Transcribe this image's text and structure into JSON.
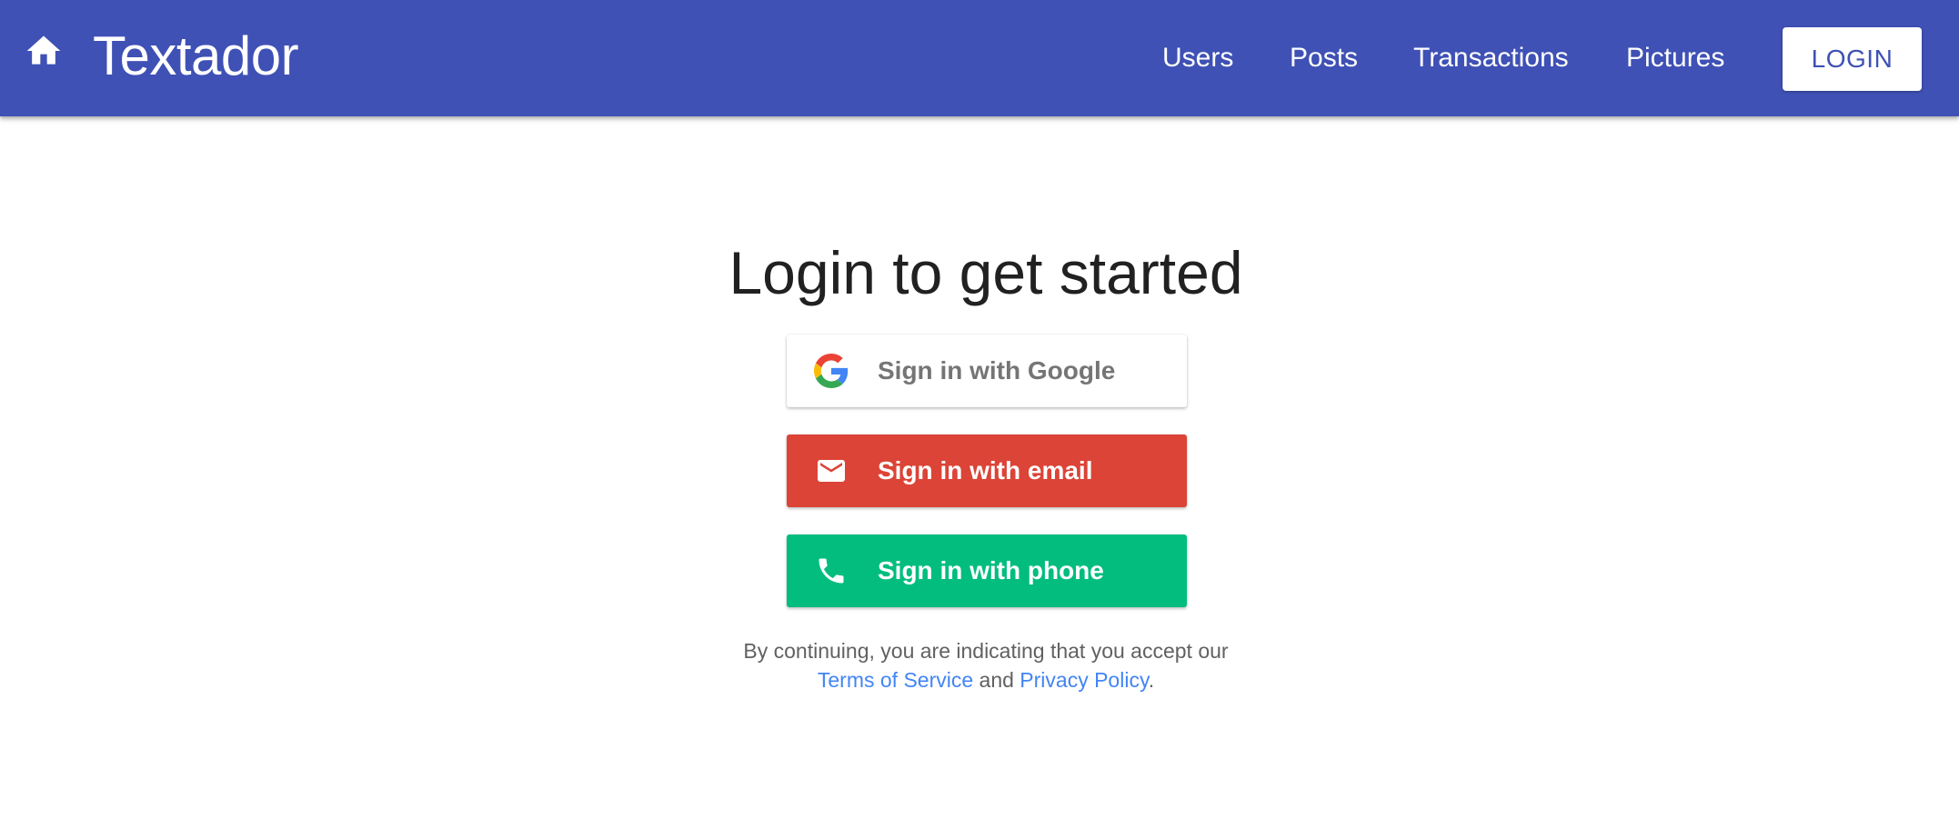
{
  "header": {
    "brand": "Textador",
    "home_icon": "home-icon",
    "nav": [
      "Users",
      "Posts",
      "Transactions",
      "Pictures"
    ],
    "login_label": "LOGIN",
    "color": "#3f51b5"
  },
  "main": {
    "heading": "Login to get started",
    "providers": {
      "google": {
        "label": "Sign in with Google",
        "icon": "google-logo-icon",
        "color": "#ffffff"
      },
      "email": {
        "label": "Sign in with email",
        "icon": "mail-icon",
        "color": "#db4437"
      },
      "phone": {
        "label": "Sign in with phone",
        "icon": "phone-icon",
        "color": "#02bd7e"
      }
    },
    "tos": {
      "line1": "By continuing, you are indicating that you accept our",
      "terms_label": "Terms of Service",
      "and": "and",
      "privacy_label": "Privacy Policy",
      "period": ".",
      "link_color": "#4285f4"
    }
  }
}
